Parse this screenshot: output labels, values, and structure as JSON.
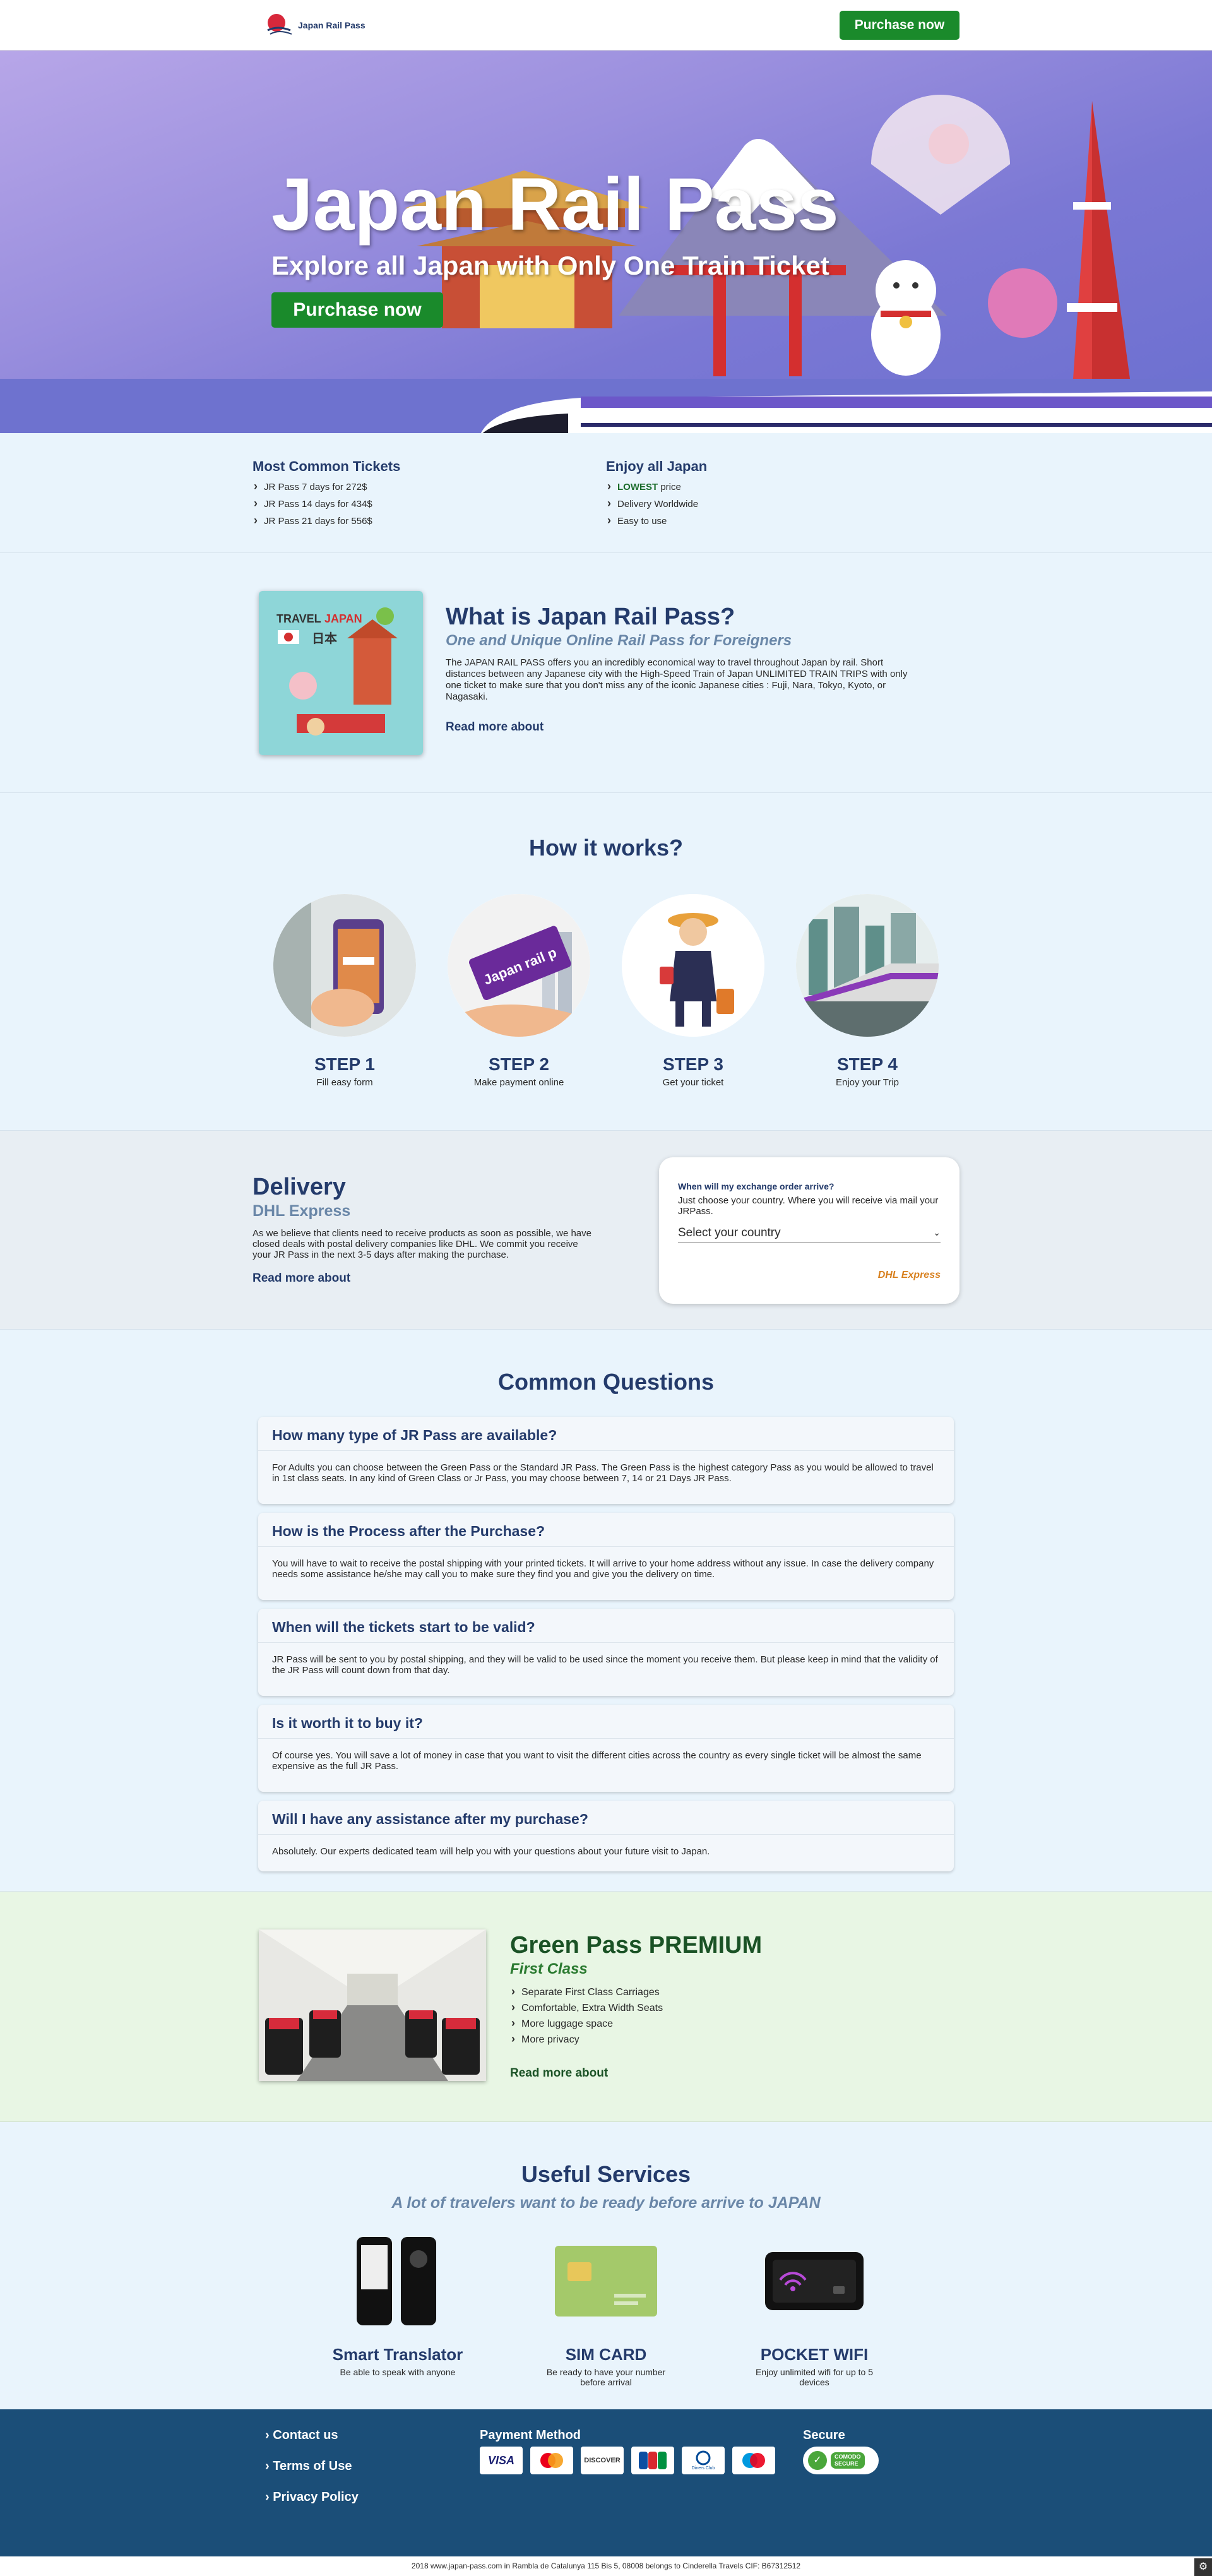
{
  "header": {
    "logo_text": "Japan Rail Pass",
    "purchase_label": "Purchase now"
  },
  "hero": {
    "title": "Japan Rail Pass",
    "subtitle": "Explore all Japan with Only One Train Ticket",
    "purchase_label": "Purchase now"
  },
  "tickets": {
    "common": {
      "title": "Most Common Tickets",
      "items": [
        "JR Pass 7 days for 272$",
        "JR Pass 14 days for 434$",
        "JR Pass 21 days for 556$"
      ]
    },
    "enjoy": {
      "title": "Enjoy all Japan",
      "lowest": "LOWEST",
      "price": " price",
      "items": [
        "Delivery Worldwide",
        "Easy to use"
      ]
    }
  },
  "whatis": {
    "card_travel": "TRAVEL",
    "card_japan": "JAPAN",
    "card_kanji": "日本",
    "title": "What is Japan Rail Pass?",
    "subtitle": "One and Unique Online Rail Pass for Foreigners",
    "body": "The JAPAN RAIL PASS offers you an incredibly economical way to travel throughout Japan by rail. Short distances between any Japanese city with the High-Speed Train of Japan UNLIMITED TRAIN TRIPS with only one ticket to make sure that you don't miss any of the iconic Japanese cities : Fuji, Nara, Tokyo, Kyoto, or Nagasaki.",
    "read_more": "Read more about"
  },
  "how": {
    "title": "How it works?",
    "card_text": "Japan rail p",
    "steps": [
      {
        "label": "STEP 1",
        "desc": "Fill easy form"
      },
      {
        "label": "STEP 2",
        "desc": "Make payment online"
      },
      {
        "label": "STEP 3",
        "desc": "Get your ticket"
      },
      {
        "label": "STEP 4",
        "desc": "Enjoy your Trip"
      }
    ]
  },
  "delivery": {
    "title": "Delivery",
    "subtitle": "DHL Express",
    "body": "As we believe that clients need to receive products as soon as possible, we have closed deals with postal delivery companies like DHL. We commit you receive your JR Pass in the next 3-5 days after making the purchase.",
    "read_more": "Read more about",
    "box_title": "When will my exchange order arrive?",
    "box_body": "Just choose your country. Where you will receive via mail your JRPass.",
    "select_value": "Select your country",
    "box_footer": "DHL Express"
  },
  "faq": {
    "title": "Common Questions",
    "items": [
      {
        "q": "How many type of JR Pass are available?",
        "a": "For Adults you can choose between the Green Pass or the Standard JR Pass. The Green Pass is the highest category Pass as you would be allowed to travel in 1st class seats. In any kind of Green Class or Jr Pass, you may choose between 7, 14 or 21 Days JR Pass."
      },
      {
        "q": "How is the Process after the Purchase?",
        "a": "You will have to wait to receive the postal shipping with your printed tickets. It will arrive to your home address without any issue. In case the delivery company needs some assistance he/she may call you to make sure they find you and give you the delivery on time."
      },
      {
        "q": "When will the tickets start to be valid?",
        "a": "JR Pass will be sent to you by postal shipping, and they will be valid to be used since the moment you receive them. But please keep in mind that the validity of the JR Pass will count down from that day."
      },
      {
        "q": "Is it worth it to buy it?",
        "a": "Of course yes. You will save a lot of money in case that you want to visit the different cities across the country as every single ticket will be almost the same expensive as the full JR Pass."
      },
      {
        "q": "Will I have any assistance after my purchase?",
        "a": "Absolutely. Our experts dedicated team will help you with your questions about your future visit to Japan."
      }
    ]
  },
  "green": {
    "title": "Green Pass PREMIUM",
    "subtitle": "First Class",
    "items": [
      "Separate First Class Carriages",
      "Comfortable, Extra Width Seats",
      "More luggage space",
      "More privacy"
    ],
    "read_more": "Read more about"
  },
  "services": {
    "title": "Useful Services",
    "subtitle": "A lot of travelers want to be ready before arrive to JAPAN",
    "items": [
      {
        "name": "Smart Translator",
        "desc": "Be able to speak with anyone"
      },
      {
        "name": "SIM CARD",
        "desc": "Be ready to have your number before arrival"
      },
      {
        "name": "POCKET WIFI",
        "desc": "Enjoy unlimited wifi for up to 5 devices"
      }
    ]
  },
  "footer": {
    "links": [
      "Contact us",
      "Terms of Use",
      "Privacy Policy"
    ],
    "payment_title": "Payment Method",
    "cards": [
      "VISA",
      "MasterCard",
      "DISCOVER",
      "JCB",
      "Diners Club",
      "Maestro"
    ],
    "secure_title": "Secure",
    "secure_badge_top": "COMODO",
    "secure_badge_bottom": "SECURE",
    "copyright": "2018 www.japan-pass.com  in Rambla de Catalunya 115 Bis 5, 08008  belongs to Cinderella Travels CIF: B67312512"
  },
  "colors": {
    "brand_navy": "#243b6b",
    "accent_green": "#1a8a2b",
    "footer_bg": "#1b4e78"
  }
}
